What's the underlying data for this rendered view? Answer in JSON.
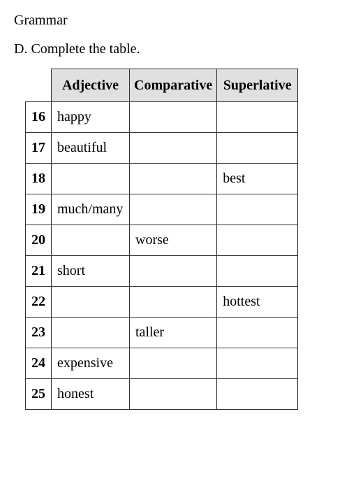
{
  "section_title": "Grammar",
  "instruction": "D.  Complete the table.",
  "headers": {
    "num": "",
    "adjective": "Adjective",
    "comparative": "Comparative",
    "superlative": "Superlative"
  },
  "rows": [
    {
      "num": "16",
      "adjective": "happy",
      "comparative": "",
      "superlative": ""
    },
    {
      "num": "17",
      "adjective": "beautiful",
      "comparative": "",
      "superlative": ""
    },
    {
      "num": "18",
      "adjective": "",
      "comparative": "",
      "superlative": "best"
    },
    {
      "num": "19",
      "adjective": "much/many",
      "comparative": "",
      "superlative": ""
    },
    {
      "num": "20",
      "adjective": "",
      "comparative": "worse",
      "superlative": ""
    },
    {
      "num": "21",
      "adjective": "short",
      "comparative": "",
      "superlative": ""
    },
    {
      "num": "22",
      "adjective": "",
      "comparative": "",
      "superlative": "hottest"
    },
    {
      "num": "23",
      "adjective": "",
      "comparative": "taller",
      "superlative": ""
    },
    {
      "num": "24",
      "adjective": "expensive",
      "comparative": "",
      "superlative": ""
    },
    {
      "num": "25",
      "adjective": "honest",
      "comparative": "",
      "superlative": ""
    }
  ]
}
